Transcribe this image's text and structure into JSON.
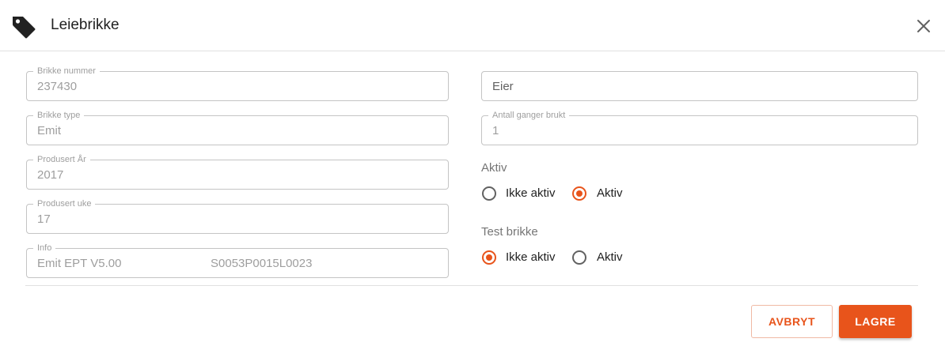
{
  "dialog": {
    "title": "Leiebrikke",
    "icon": "tag-icon",
    "close_icon": "close-icon"
  },
  "fields": {
    "brikke_nummer": {
      "label": "Brikke nummer",
      "value": "237430"
    },
    "brikke_type": {
      "label": "Brikke type",
      "value": "Emit"
    },
    "produsert_ar": {
      "label": "Produsert År",
      "value": "2017"
    },
    "produsert_uke": {
      "label": "Produsert uke",
      "value": "17"
    },
    "info": {
      "label": "Info",
      "value_a": "Emit EPT V5.00",
      "value_b": "S0053P0015L0023"
    },
    "eier": {
      "placeholder": "Eier",
      "value": ""
    },
    "antall_ganger_brukt": {
      "label": "Antall ganger brukt",
      "value": "1"
    }
  },
  "aktiv": {
    "label": "Aktiv",
    "options": [
      {
        "label": "Ikke aktiv",
        "checked": false
      },
      {
        "label": "Aktiv",
        "checked": true
      }
    ]
  },
  "test_brikke": {
    "label": "Test brikke",
    "options": [
      {
        "label": "Ikke aktiv",
        "checked": true
      },
      {
        "label": "Aktiv",
        "checked": false
      }
    ]
  },
  "actions": {
    "cancel_label": "AVBRYT",
    "save_label": "LAGRE"
  },
  "colors": {
    "accent": "#e8541b",
    "border": "#c4c4c4",
    "muted_text": "#9e9e9e"
  }
}
